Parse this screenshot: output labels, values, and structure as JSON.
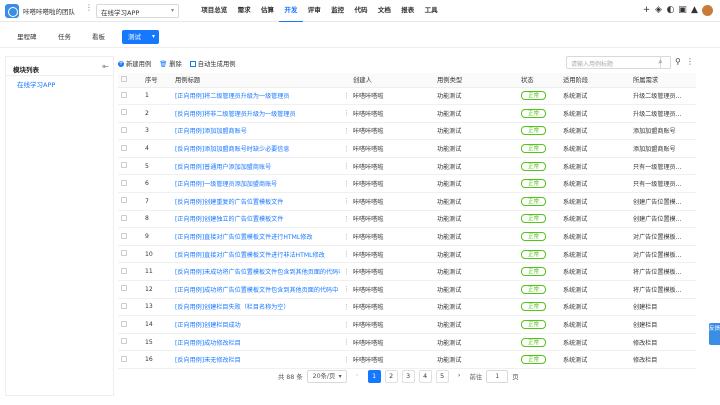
{
  "header": {
    "team_name": "咔嗒咔嗒啦的团队",
    "more": "⋮",
    "project": "在线学习APP",
    "nav": [
      "项目总览",
      "需求",
      "估算",
      "开发",
      "评审",
      "监控",
      "代码",
      "文档",
      "报表",
      "工具"
    ],
    "active_nav": "开发",
    "icons": [
      "add-icon",
      "layers-icon",
      "half-circle-icon",
      "box-icon",
      "bell-icon",
      "avatar"
    ]
  },
  "subnav": {
    "tabs": [
      "里程碑",
      "任务",
      "看板"
    ],
    "active_dropdown": "测试"
  },
  "sidebar": {
    "title": "模块列表",
    "items": [
      "在线学习APP"
    ]
  },
  "toolbar": {
    "new_case": "新建用例",
    "delete": "删除",
    "auto_generate": "自动生成用例",
    "search_placeholder": "请输入用例标题"
  },
  "table": {
    "headers": [
      "",
      "序号",
      "用例标题",
      "",
      "创建人",
      "用例类型",
      "状态",
      "适用阶段",
      "所属需求"
    ],
    "rows": [
      {
        "no": "1",
        "title": "[正向用例]将二级管理员升级为一级管理员",
        "creator": "咔嗒咔嗒啦",
        "type": "功能测试",
        "status": "正常",
        "stage": "系统测试",
        "req": "升级二级管理员..."
      },
      {
        "no": "2",
        "title": "[反向用例]将非二级管理员升级为一级管理员",
        "creator": "咔嗒咔嗒啦",
        "type": "功能测试",
        "status": "正常",
        "stage": "系统测试",
        "req": "升级二级管理员..."
      },
      {
        "no": "3",
        "title": "[正向用例]添加加盟商账号",
        "creator": "咔嗒咔嗒啦",
        "type": "功能测试",
        "status": "正常",
        "stage": "系统测试",
        "req": "添加加盟商账号"
      },
      {
        "no": "4",
        "title": "[反向用例]添加加盟商账号时缺少必要信息",
        "creator": "咔嗒咔嗒啦",
        "type": "功能测试",
        "status": "正常",
        "stage": "系统测试",
        "req": "添加加盟商账号"
      },
      {
        "no": "5",
        "title": "[反向用例]普通用户添加加盟商账号",
        "creator": "咔嗒咔嗒啦",
        "type": "功能测试",
        "status": "正常",
        "stage": "系统测试",
        "req": "只有一级管理员..."
      },
      {
        "no": "6",
        "title": "[正向用例]一级管理员添加加盟商账号",
        "creator": "咔嗒咔嗒啦",
        "type": "功能测试",
        "status": "正常",
        "stage": "系统测试",
        "req": "只有一级管理员..."
      },
      {
        "no": "7",
        "title": "[反向用例]创建重复的广告位置模板文件",
        "creator": "咔嗒咔嗒啦",
        "type": "功能测试",
        "status": "正常",
        "stage": "系统测试",
        "req": "创建广告位置模..."
      },
      {
        "no": "8",
        "title": "[正向用例]创建独立的广告位置模板文件",
        "creator": "咔嗒咔嗒啦",
        "type": "功能测试",
        "status": "正常",
        "stage": "系统测试",
        "req": "创建广告位置模..."
      },
      {
        "no": "9",
        "title": "[正向用例]直接对广告位置模板文件进行HTML修改",
        "creator": "咔嗒咔嗒啦",
        "type": "功能测试",
        "status": "正常",
        "stage": "系统测试",
        "req": "对广告位置模板..."
      },
      {
        "no": "10",
        "title": "[反向用例]直接对广告位置模板文件进行非法HTML修改",
        "creator": "咔嗒咔嗒啦",
        "type": "功能测试",
        "status": "正常",
        "stage": "系统测试",
        "req": "对广告位置模板..."
      },
      {
        "no": "11",
        "title": "[反向用例]未成功将广告位置模板文件包含到其他页面的代码中",
        "creator": "咔嗒咔嗒啦",
        "type": "功能测试",
        "status": "正常",
        "stage": "系统测试",
        "req": "将广告位置模板..."
      },
      {
        "no": "12",
        "title": "[正向用例]成功将广告位置模板文件包含到其他页面的代码中",
        "creator": "咔嗒咔嗒啦",
        "type": "功能测试",
        "status": "正常",
        "stage": "系统测试",
        "req": "将广告位置模板..."
      },
      {
        "no": "13",
        "title": "[反向用例]创建栏目失败（栏目名称为空）",
        "creator": "咔嗒咔嗒啦",
        "type": "功能测试",
        "status": "正常",
        "stage": "系统测试",
        "req": "创建栏目"
      },
      {
        "no": "14",
        "title": "[正向用例]创建栏目成功",
        "creator": "咔嗒咔嗒啦",
        "type": "功能测试",
        "status": "正常",
        "stage": "系统测试",
        "req": "创建栏目"
      },
      {
        "no": "15",
        "title": "[正向用例]成功修改栏目",
        "creator": "咔嗒咔嗒啦",
        "type": "功能测试",
        "status": "正常",
        "stage": "系统测试",
        "req": "修改栏目"
      },
      {
        "no": "16",
        "title": "[反向用例]未无修改栏目",
        "creator": "咔嗒咔嗒啦",
        "type": "功能测试",
        "status": "正常",
        "stage": "系统测试",
        "req": "修改栏目"
      }
    ]
  },
  "pagination": {
    "total": "共 88 条",
    "page_size": "20条/页",
    "pages": [
      "1",
      "2",
      "3",
      "4",
      "5"
    ],
    "current": "1",
    "goto_label": "前往",
    "goto_value": "1",
    "page_unit": "页"
  },
  "feedback": "反馈",
  "colors": {
    "accent": "#1677ff",
    "status_green": "#52c41a"
  }
}
